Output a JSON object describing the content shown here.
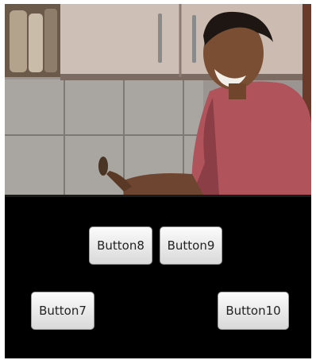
{
  "photo": {
    "icon": "kitchen-photo-person-laughing"
  },
  "buttons": {
    "button8": "Button8",
    "button9": "Button9",
    "button7": "Button7",
    "button10": "Button10"
  },
  "colors": {
    "background": "#000000",
    "button_face": "#e8e8e8",
    "button_text": "#222222"
  }
}
